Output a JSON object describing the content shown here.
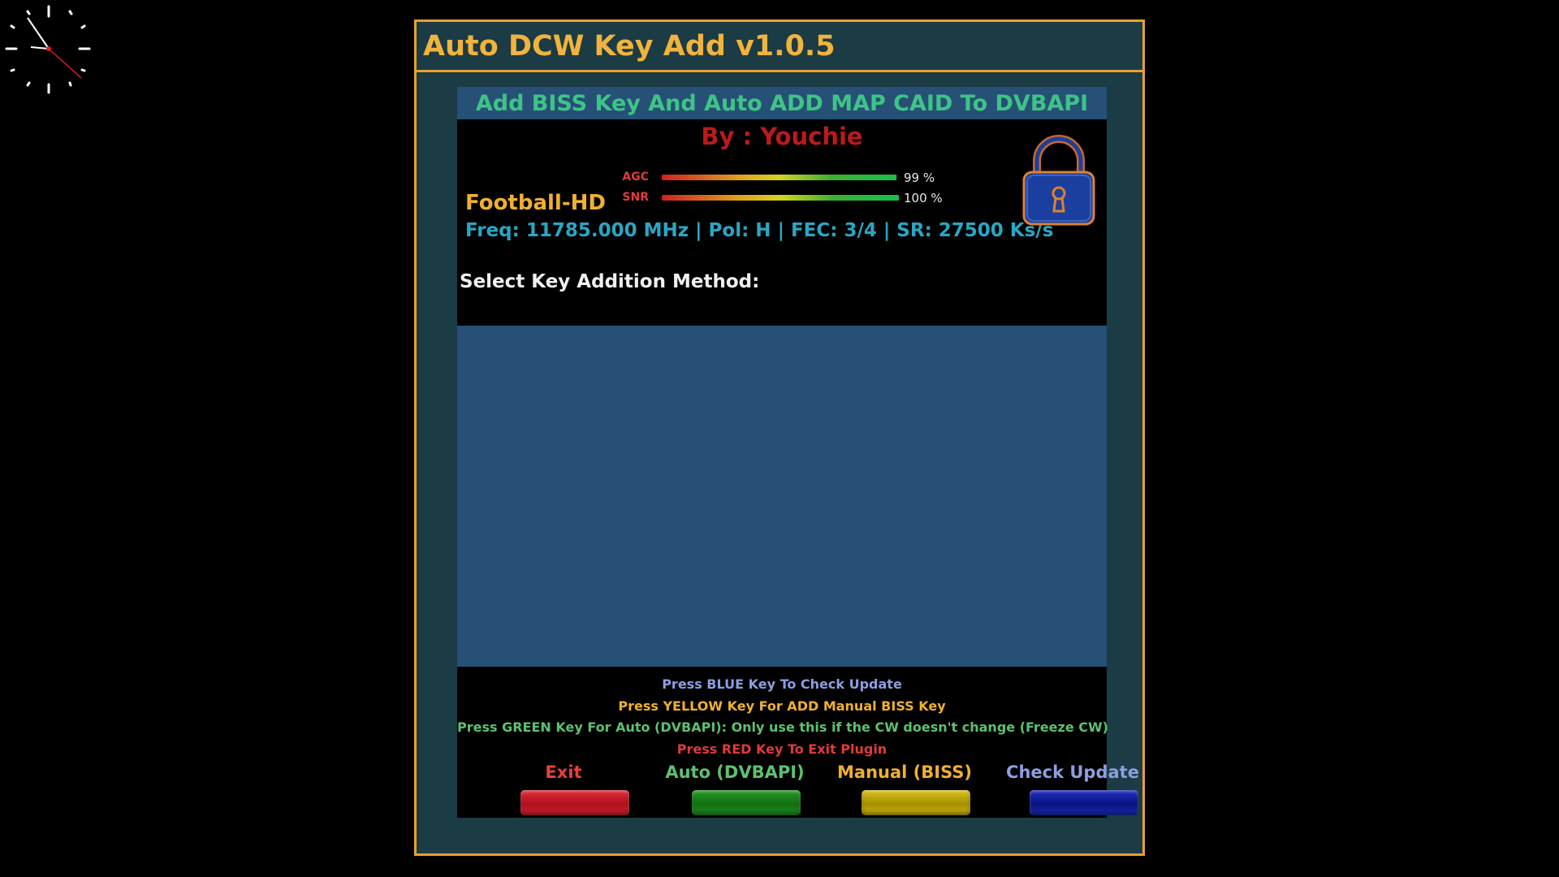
{
  "app": {
    "title": "Auto DCW Key Add v1.0.5"
  },
  "header": {
    "subtitle": "Add BISS Key And Auto ADD MAP CAID To DVBAPI",
    "author": "By : Youchie"
  },
  "signal": {
    "agc": {
      "label": "AGC",
      "value_text": "99 %",
      "level_percent": 99
    },
    "snr": {
      "label": "SNR",
      "value_text": "100 %",
      "level_percent": 100
    }
  },
  "channel": {
    "name": "Football-HD",
    "info": "Freq: 11785.000 MHz | Pol: H | FEC: 3/4 | SR: 27500 Ks/s"
  },
  "icons": {
    "clock": "clock-icon",
    "lock": "lock-icon"
  },
  "method": {
    "prompt": "Select Key Addition Method:"
  },
  "hints": {
    "blue": "Press BLUE Key To Check Update",
    "yellow": "Press YELLOW Key For ADD Manual BISS Key",
    "green": "Press GREEN Key For Auto (DVBAPI): Only use this if the CW doesn't change (Freeze CW)",
    "red": "Press RED Key To Exit Plugin"
  },
  "buttons": {
    "exit": "Exit",
    "auto": "Auto (DVBAPI)",
    "manual": "Manual (BISS)",
    "update": "Check Update"
  },
  "colors": {
    "frame": "#e8a030",
    "window_bg": "#1b3b45",
    "accent_blue": "#265076",
    "red_key": "#d02030",
    "green_key": "#208a20",
    "yellow_key": "#c8b010",
    "blue_key": "#1a28b0"
  }
}
